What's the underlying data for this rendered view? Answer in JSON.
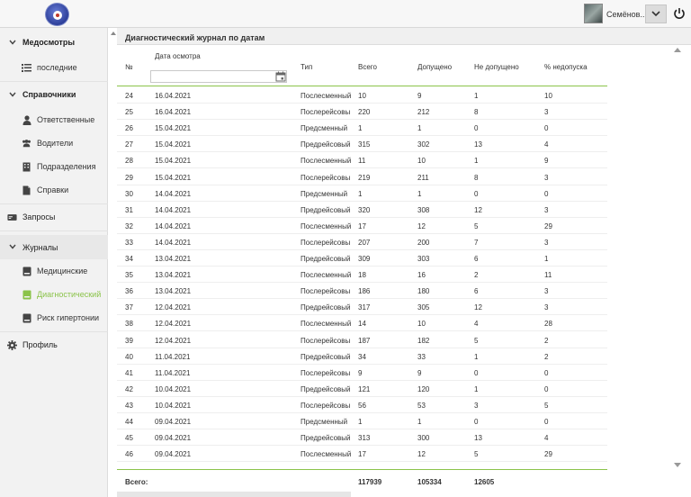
{
  "header": {
    "username": "Семёнов...",
    "icons": {
      "logo": "app-logo",
      "avatar": "user-avatar",
      "caret": "chevron-down-icon",
      "power": "power-icon"
    }
  },
  "sidebar": {
    "items": [
      {
        "label": "Медосмотры",
        "type": "group",
        "icon": "chevron-down-icon"
      },
      {
        "label": "последние",
        "type": "sub",
        "icon": "list-icon"
      },
      {
        "label": "Справочники",
        "type": "group",
        "icon": "chevron-down-icon"
      },
      {
        "label": "Ответственные",
        "type": "sub",
        "icon": "user-icon"
      },
      {
        "label": "Водители",
        "type": "sub",
        "icon": "users-icon"
      },
      {
        "label": "Подразделения",
        "type": "sub",
        "icon": "building-icon"
      },
      {
        "label": "Справки",
        "type": "sub",
        "icon": "document-icon"
      },
      {
        "label": "Запросы",
        "type": "top",
        "icon": "card-icon"
      },
      {
        "label": "Журналы",
        "type": "group-plain",
        "icon": "chevron-down-icon"
      },
      {
        "label": "Медицинские",
        "type": "sub",
        "icon": "journal-icon"
      },
      {
        "label": "Диагностический",
        "type": "sub-active",
        "icon": "journal-icon"
      },
      {
        "label": "Риск гипертонии",
        "type": "sub",
        "icon": "journal-icon"
      },
      {
        "label": "Профиль",
        "type": "top",
        "icon": "gear-icon"
      }
    ],
    "active_color": "#8bc34a"
  },
  "main": {
    "title": "Диагностический журнал по датам",
    "columns": {
      "num": "№",
      "date": "Дата осмотра",
      "type": "Тип",
      "total": "Всего",
      "allowed": "Допущено",
      "denied": "Не допущено",
      "pct": "% недопуска"
    },
    "rows": [
      [
        "24",
        "16.04.2021",
        "Послесменный",
        "10",
        "9",
        "1",
        "10"
      ],
      [
        "25",
        "16.04.2021",
        "Послерейсовы",
        "220",
        "212",
        "8",
        "3"
      ],
      [
        "26",
        "15.04.2021",
        "Предсменный",
        "1",
        "1",
        "0",
        "0"
      ],
      [
        "27",
        "15.04.2021",
        "Предрейсовый",
        "315",
        "302",
        "13",
        "4"
      ],
      [
        "28",
        "15.04.2021",
        "Послесменный",
        "11",
        "10",
        "1",
        "9"
      ],
      [
        "29",
        "15.04.2021",
        "Послерейсовы",
        "219",
        "211",
        "8",
        "3"
      ],
      [
        "30",
        "14.04.2021",
        "Предсменный",
        "1",
        "1",
        "0",
        "0"
      ],
      [
        "31",
        "14.04.2021",
        "Предрейсовый",
        "320",
        "308",
        "12",
        "3"
      ],
      [
        "32",
        "14.04.2021",
        "Послесменный",
        "17",
        "12",
        "5",
        "29"
      ],
      [
        "33",
        "14.04.2021",
        "Послерейсовы",
        "207",
        "200",
        "7",
        "3"
      ],
      [
        "34",
        "13.04.2021",
        "Предрейсовый",
        "309",
        "303",
        "6",
        "1"
      ],
      [
        "35",
        "13.04.2021",
        "Послесменный",
        "18",
        "16",
        "2",
        "11"
      ],
      [
        "36",
        "13.04.2021",
        "Послерейсовы",
        "186",
        "180",
        "6",
        "3"
      ],
      [
        "37",
        "12.04.2021",
        "Предрейсовый",
        "317",
        "305",
        "12",
        "3"
      ],
      [
        "38",
        "12.04.2021",
        "Послесменный",
        "14",
        "10",
        "4",
        "28"
      ],
      [
        "39",
        "12.04.2021",
        "Послерейсовы",
        "187",
        "182",
        "5",
        "2"
      ],
      [
        "40",
        "11.04.2021",
        "Предрейсовый",
        "34",
        "33",
        "1",
        "2"
      ],
      [
        "41",
        "11.04.2021",
        "Послерейсовы",
        "9",
        "9",
        "0",
        "0"
      ],
      [
        "42",
        "10.04.2021",
        "Предрейсовый",
        "121",
        "120",
        "1",
        "0"
      ],
      [
        "43",
        "10.04.2021",
        "Послерейсовы",
        "56",
        "53",
        "3",
        "5"
      ],
      [
        "44",
        "09.04.2021",
        "Предсменный",
        "1",
        "1",
        "0",
        "0"
      ],
      [
        "45",
        "09.04.2021",
        "Предрейсовый",
        "313",
        "300",
        "13",
        "4"
      ],
      [
        "46",
        "09.04.2021",
        "Послесменный",
        "17",
        "12",
        "5",
        "29"
      ]
    ],
    "footer": {
      "label": "Всего:",
      "total": "117939",
      "allowed": "105334",
      "denied": "12605"
    }
  }
}
